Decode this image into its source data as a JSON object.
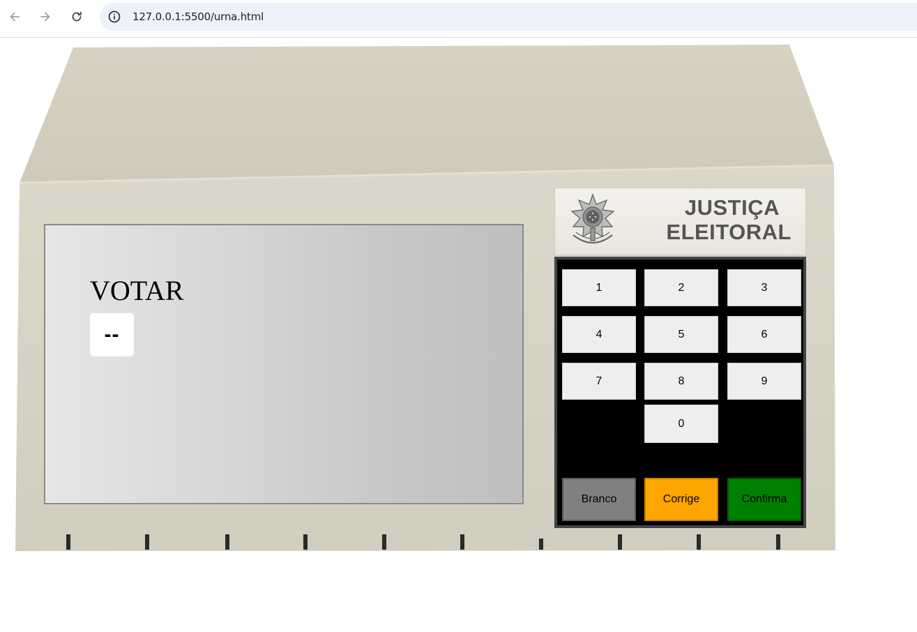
{
  "browser": {
    "url": "127.0.0.1:5500/urna.html"
  },
  "screen": {
    "title": "VOTAR",
    "digit": "--"
  },
  "brand": {
    "line1": "JUSTIÇA",
    "line2": "ELEITORAL"
  },
  "keypad": {
    "digits": [
      "1",
      "2",
      "3",
      "4",
      "5",
      "6",
      "7",
      "8",
      "9",
      "0"
    ],
    "branco": "Branco",
    "corrige": "Corrige",
    "confirma": "Confirma"
  },
  "colors": {
    "branco": "#808080",
    "corrige": "#ffa500",
    "confirma": "#008000",
    "machine": "#d9d5c7"
  }
}
